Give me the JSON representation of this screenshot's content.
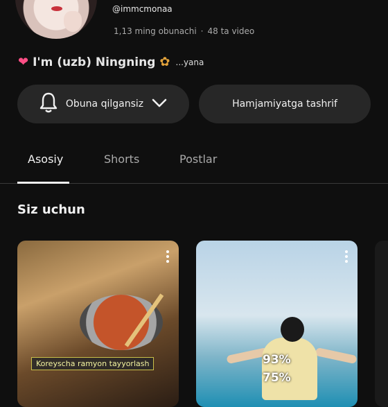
{
  "channel": {
    "handle": "@immcmonaa",
    "subscribers": "1,13 ming obunachi",
    "separator": "·",
    "videos": "48 ta video",
    "bio_name": "I'm (uzb) Ningning",
    "bio_tail": "...yana"
  },
  "buttons": {
    "subscribe": "Obuna qilgansiz",
    "community": "Hamjamiyatga tashrif"
  },
  "tabs": [
    {
      "label": "Asosiy",
      "active": true
    },
    {
      "label": "Shorts",
      "active": false
    },
    {
      "label": "Postlar",
      "active": false
    }
  ],
  "section": {
    "title": "Siz uchun"
  },
  "cards": [
    {
      "caption": "Koreyscha ramyon tayyorlash"
    },
    {
      "overlay_top": "93%",
      "overlay_bottom": "75%"
    }
  ],
  "icons": {
    "bell": "bell-icon",
    "chevron": "chevron-down-icon",
    "more": "more-vertical-icon"
  },
  "colors": {
    "background": "#0f0f0f",
    "button_bg": "#272727",
    "text_primary": "#f1f1f1",
    "text_secondary": "#aaaaaa"
  }
}
